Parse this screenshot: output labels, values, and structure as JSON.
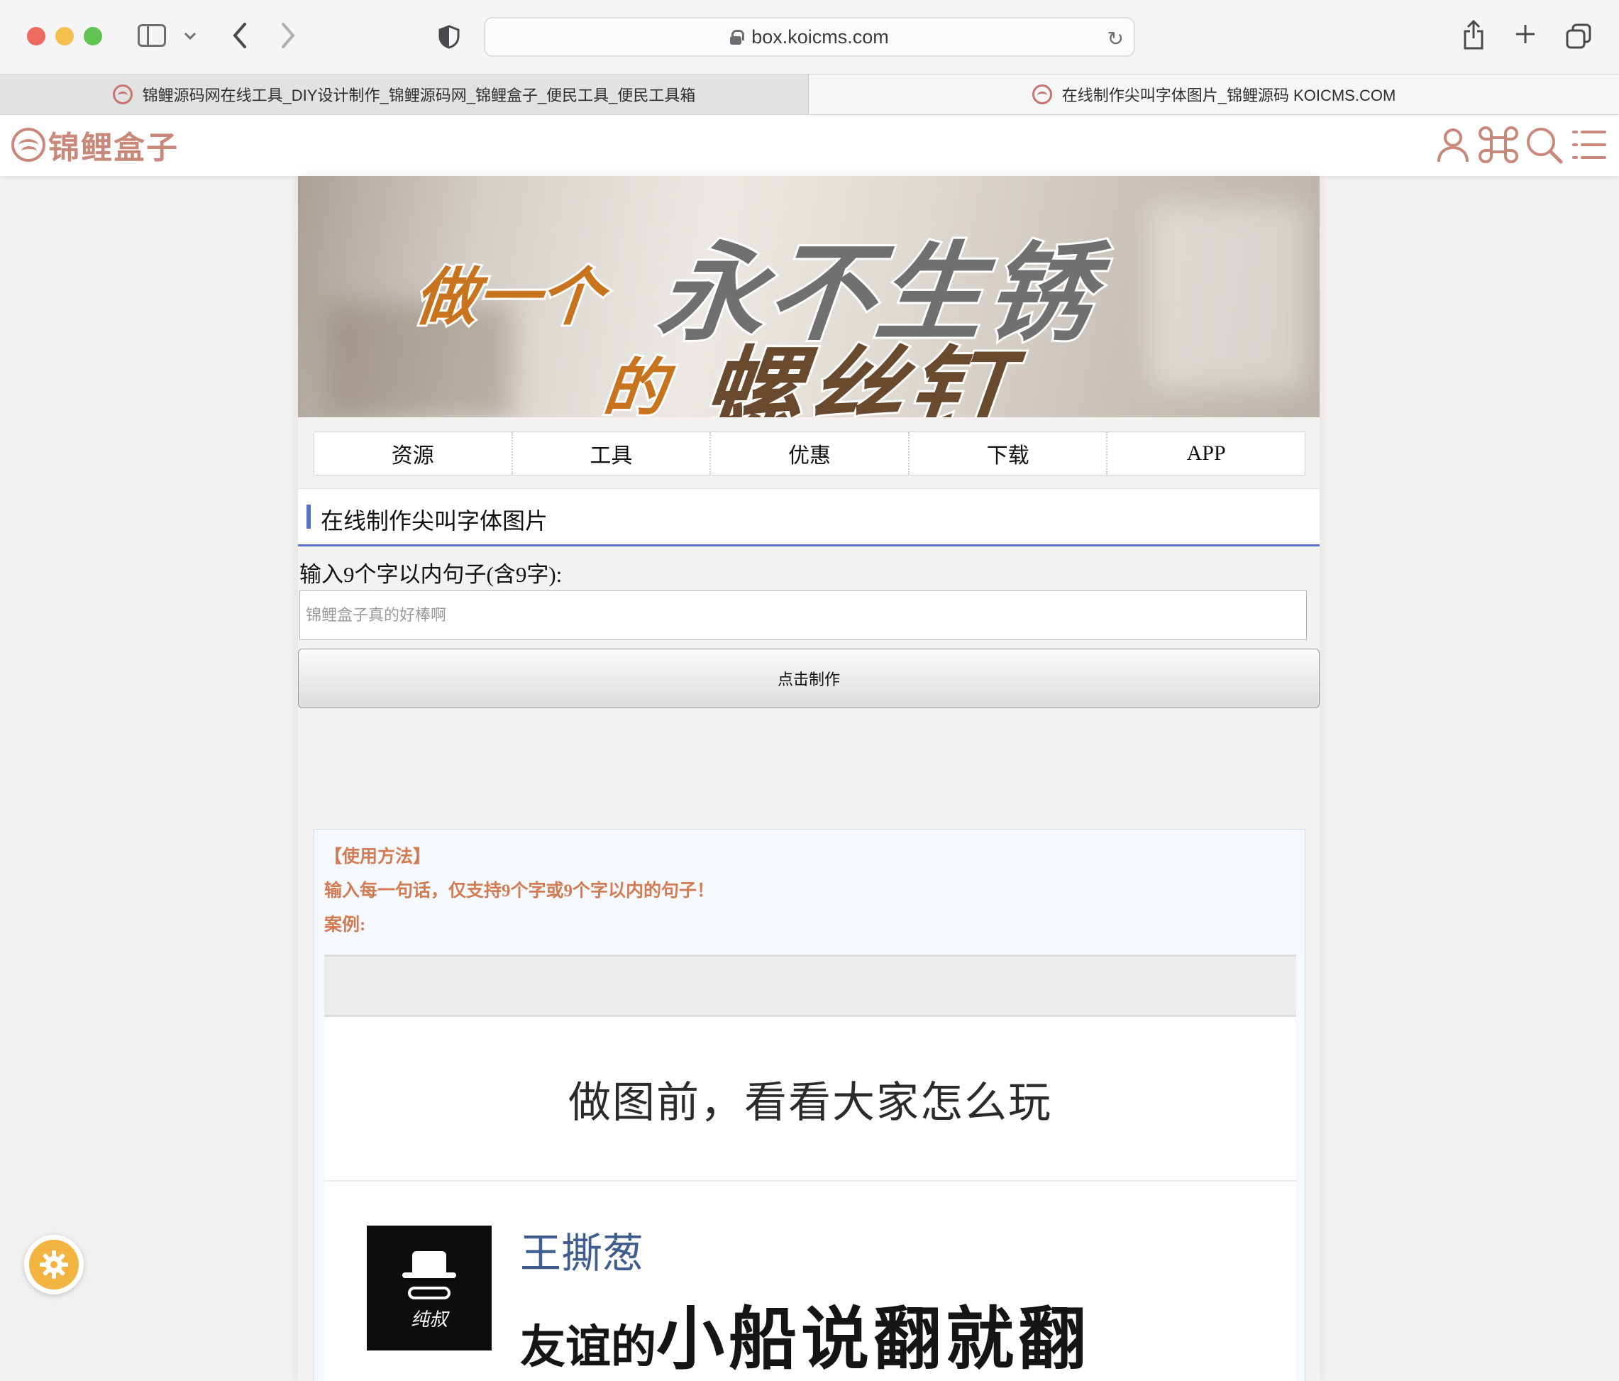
{
  "browser": {
    "url": "box.koicms.com",
    "tabs": [
      {
        "title": "锦鲤源码网在线工具_DIY设计制作_锦鲤源码网_锦鲤盒子_便民工具_便民工具箱",
        "active": true
      },
      {
        "title": "在线制作尖叫字体图片_锦鲤源码 KOICMS.COM",
        "active": false
      }
    ],
    "icons": [
      "close-window",
      "minimize-window",
      "zoom-window",
      "sidebar-icon",
      "chevron-down-icon",
      "back-arrow-icon",
      "forward-arrow-icon",
      "shield-icon",
      "lock-icon",
      "reload-icon",
      "share-icon",
      "plus-icon",
      "tab-overview-icon"
    ]
  },
  "site": {
    "logo_text": "锦鲤盒子",
    "header_icons": [
      "user-icon",
      "apps-icon",
      "search-icon",
      "menu-icon"
    ],
    "accent": "#c8897a"
  },
  "banner": {
    "line1_small": "做一个",
    "line1_big": "永不生锈",
    "line2_small": "的",
    "line2_big": "螺丝钉"
  },
  "nav": [
    {
      "label": "资源"
    },
    {
      "label": "工具"
    },
    {
      "label": "优惠"
    },
    {
      "label": "下载"
    },
    {
      "label": "APP"
    }
  ],
  "section": {
    "title": "在线制作尖叫字体图片",
    "accent": "#5b6fd1"
  },
  "form": {
    "label": "输入9个字以内句子(含9字):",
    "placeholder": "锦鲤盒子真的好棒啊",
    "value": "",
    "submit_label": "点击制作"
  },
  "help": {
    "heading": "【使用方法】",
    "instruction": "输入每一句话，仅支持9个字或9个字以内的句子！",
    "example_label": "案例:",
    "text_color": "#d27c54"
  },
  "example": {
    "title": "做图前，看看大家怎么玩",
    "author": "王撕葱",
    "quote_prefix": "友谊的",
    "quote_main": "小船说翻就翻",
    "avatar_signature": "纯叔"
  },
  "floating": {
    "icon": "gear-icon",
    "color": "#f2b340"
  }
}
